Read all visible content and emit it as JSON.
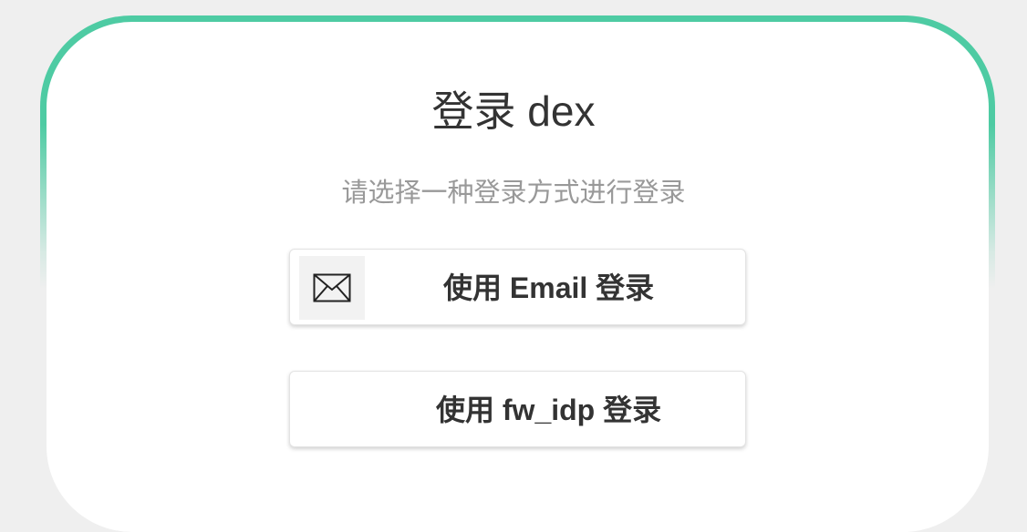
{
  "page": {
    "title": "登录 dex",
    "subtitle": "请选择一种登录方式进行登录"
  },
  "connectors": {
    "email": {
      "label": "使用 Email 登录",
      "icon": "mail-envelope-icon"
    },
    "fw_idp": {
      "label": "使用 fw_idp 登录"
    }
  },
  "colors": {
    "accent": "#4ecba3",
    "background": "#efefef",
    "card": "#ffffff",
    "title_text": "#333333",
    "subtitle_text": "#999999"
  }
}
